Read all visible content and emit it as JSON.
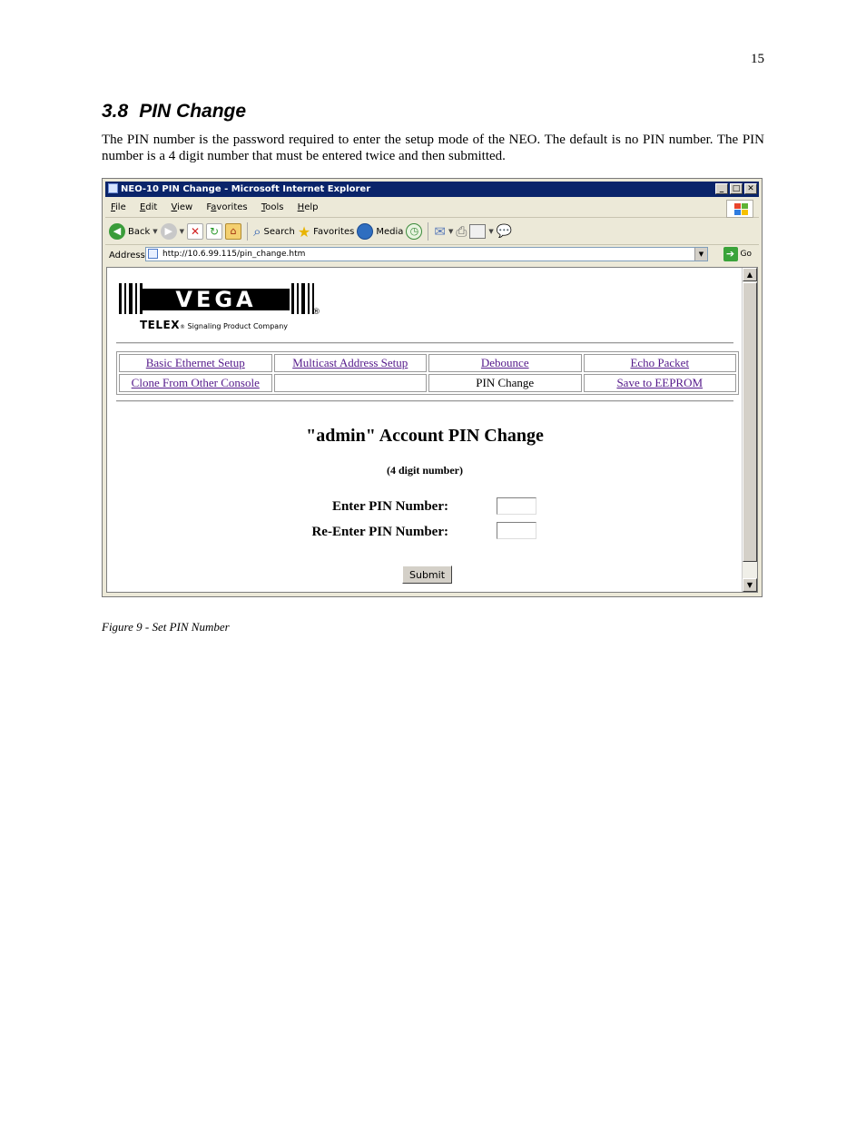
{
  "page_number": "15",
  "section": {
    "number": "3.8",
    "title": "PIN Change"
  },
  "body_text": "The PIN number is the password required to enter the setup mode of the NEO.  The default is no PIN number.  The PIN number is a 4 digit number that must be entered twice and then submitted.",
  "figure_caption": "Figure 9 - Set PIN Number",
  "browser": {
    "window_title": "NEO-10 PIN Change - Microsoft Internet Explorer",
    "menu": [
      {
        "key": "F",
        "rest": "ile"
      },
      {
        "key": "E",
        "rest": "dit"
      },
      {
        "key": "V",
        "rest": "iew",
        "pre": ""
      },
      {
        "key": "a",
        "pre": "F",
        "rest": "vorites"
      },
      {
        "key": "T",
        "rest": "ools"
      },
      {
        "key": "H",
        "rest": "elp"
      }
    ],
    "toolbar": {
      "back": "Back",
      "search": "Search",
      "favorites": "Favorites",
      "media": "Media"
    },
    "address_label": "Address",
    "url": "http://10.6.99.115/pin_change.htm",
    "go": "Go"
  },
  "page": {
    "logo_word": "VEGA",
    "logo_brand": "TELEX",
    "logo_tagline": "Signaling Product Company",
    "nav": [
      [
        "Basic Ethernet Setup",
        "Multicast Address Setup",
        "Debounce",
        "Echo Packet"
      ],
      [
        "Clone From Other Console",
        "",
        "PIN Change",
        "Save to EEPROM"
      ]
    ],
    "heading": "\"admin\" Account PIN Change",
    "subheading": "(4 digit number)",
    "enter_label": "Enter PIN Number:",
    "reenter_label": "Re-Enter PIN Number:",
    "enter_value": "",
    "reenter_value": "",
    "submit_label": "Submit"
  },
  "colors": {
    "titlebar": "#0a246a",
    "link": "#551a8b",
    "window_bg": "#ece9d8"
  }
}
